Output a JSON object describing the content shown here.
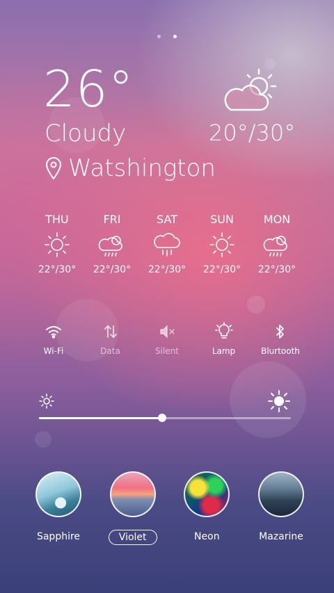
{
  "pager": {
    "dots": 2,
    "active": 1
  },
  "current": {
    "temperature": "26°",
    "condition": "Cloudy",
    "location": "Watshington",
    "range": "20°/30°",
    "icon": "partly-cloudy-icon"
  },
  "forecast": [
    {
      "day": "THU",
      "temp": "22°/30°",
      "icon": "sun-icon"
    },
    {
      "day": "FRI",
      "temp": "22°/30°",
      "icon": "cloud-rain-icon"
    },
    {
      "day": "SAT",
      "temp": "22°/30°",
      "icon": "rain-icon"
    },
    {
      "day": "SUN",
      "temp": "22°/30°",
      "icon": "sun-icon"
    },
    {
      "day": "MON",
      "temp": "22°/30°",
      "icon": "cloud-rain-icon"
    }
  ],
  "toggles": [
    {
      "label": "Wi-Fi",
      "icon": "wifi-icon",
      "active": true
    },
    {
      "label": "Data",
      "icon": "data-arrows-icon",
      "active": false
    },
    {
      "label": "Silent",
      "icon": "mute-icon",
      "active": false
    },
    {
      "label": "Lamp",
      "icon": "lamp-icon",
      "active": true
    },
    {
      "label": "Blurtooth",
      "icon": "bluetooth-icon",
      "active": true
    }
  ],
  "brightness": {
    "level": 0.49
  },
  "themes": [
    {
      "name": "Sapphire",
      "selected": false
    },
    {
      "name": "Violet",
      "selected": true
    },
    {
      "name": "Neon",
      "selected": false
    },
    {
      "name": "Mazarine",
      "selected": false
    }
  ]
}
